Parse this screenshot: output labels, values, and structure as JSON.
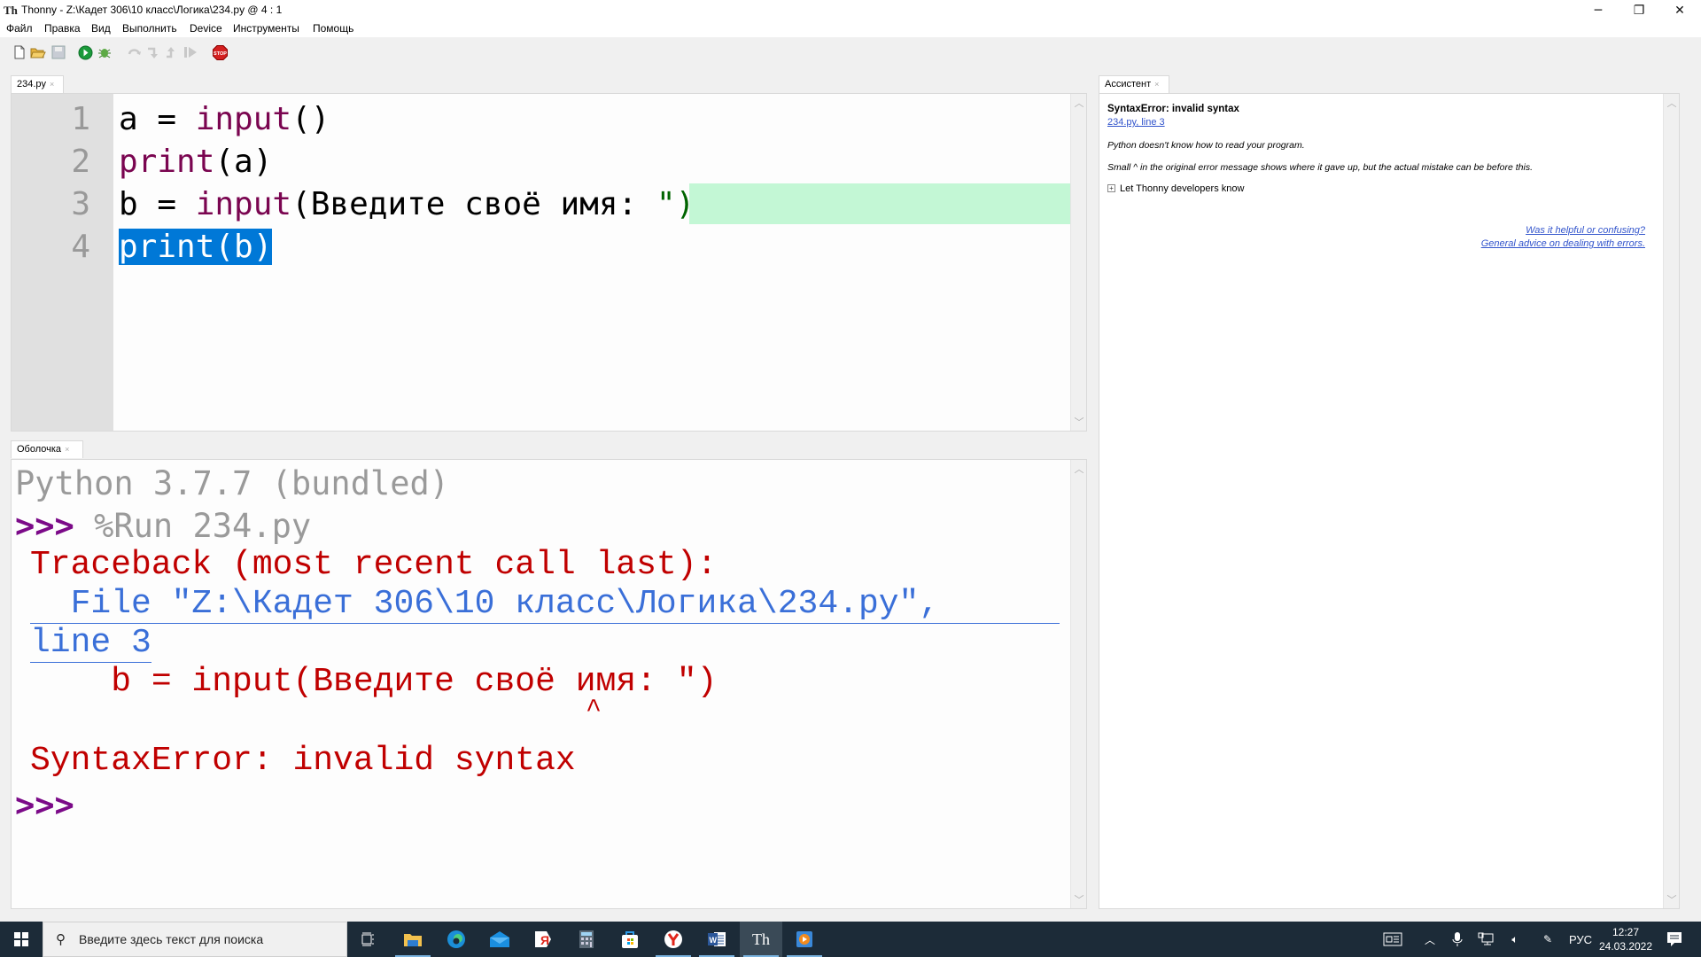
{
  "window": {
    "app_icon": "Th",
    "title": "Thonny  -  Z:\\Кадет 306\\10 класс\\Логика\\234.py  @  4 : 1",
    "controls": {
      "minimize": "─",
      "restore": "❐",
      "close": "✕"
    }
  },
  "menu": [
    "Файл",
    "Правка",
    "Вид",
    "Выполнить",
    "Device",
    "Инструменты",
    "Помощь"
  ],
  "toolbar": {
    "buttons": [
      {
        "name": "new-file",
        "icon": "new-file-icon",
        "enabled": true
      },
      {
        "name": "open-file",
        "icon": "folder-open-icon",
        "enabled": true
      },
      {
        "name": "save-file",
        "icon": "save-icon",
        "enabled": false
      },
      {
        "name": "run",
        "icon": "run-icon",
        "enabled": true
      },
      {
        "name": "debug",
        "icon": "bug-icon",
        "enabled": true
      },
      {
        "name": "step-over",
        "icon": "step-over-icon",
        "enabled": false
      },
      {
        "name": "step-into",
        "icon": "step-into-icon",
        "enabled": false
      },
      {
        "name": "step-out",
        "icon": "step-out-icon",
        "enabled": false
      },
      {
        "name": "resume",
        "icon": "resume-icon",
        "enabled": false
      },
      {
        "name": "stop",
        "icon": "stop-icon",
        "label": "STOP",
        "enabled": true
      }
    ]
  },
  "editor": {
    "tab": {
      "label": "234.py",
      "close": "×"
    },
    "lines": [
      {
        "n": "1",
        "tokens": [
          [
            "a = ",
            "plain"
          ],
          [
            "input",
            "kw"
          ],
          [
            "()",
            "plain"
          ]
        ]
      },
      {
        "n": "2",
        "tokens": [
          [
            "print",
            "kw"
          ],
          [
            "(a)",
            "plain"
          ]
        ]
      },
      {
        "n": "3",
        "tokens": [
          [
            "b = ",
            "plain"
          ],
          [
            "input",
            "kw"
          ],
          [
            "(Введите своё имя: ",
            "plain"
          ],
          [
            "\")",
            "str"
          ]
        ]
      },
      {
        "n": "4",
        "tokens": [
          [
            "print(b)",
            "sel"
          ]
        ]
      }
    ],
    "error_line": 3,
    "selected_line": 4
  },
  "shell": {
    "tab": {
      "label": "Оболочка",
      "close": "×"
    },
    "banner": "Python 3.7.7 (bundled)",
    "prompt": ">>>",
    "command": " %Run 234.py",
    "traceback_header": "Traceback (most recent call last):",
    "traceback_file": "  File \"Z:\\Кадет 306\\10 класс\\Логика\\234.py\",",
    "traceback_line": "line 3",
    "source_line": "    b = input(Введите своё имя: \")",
    "caret": "^",
    "error": "SyntaxError: invalid syntax",
    "final_prompt": ">>>"
  },
  "assistant": {
    "tab": {
      "label": "Ассистент",
      "close": "×"
    },
    "title": "SyntaxError: invalid syntax",
    "location_link": "234.py, line 3",
    "paragraphs": [
      "Python doesn't know how to read your program.",
      "Small ^ in the original error message shows where it gave up, but the actual mistake can be before this."
    ],
    "expand_label": "Let Thonny developers know",
    "links": [
      "Was it helpful or confusing?",
      "General advice on dealing with errors."
    ]
  },
  "taskbar": {
    "search_placeholder": "Введите здесь текст для поиска",
    "apps": [
      {
        "name": "task-view",
        "icon": "task-view-icon"
      },
      {
        "name": "file-explorer",
        "icon": "folder-icon",
        "running": true
      },
      {
        "name": "edge",
        "icon": "edge-icon"
      },
      {
        "name": "mail",
        "icon": "mail-icon"
      },
      {
        "name": "yandex",
        "icon": "yandex-icon"
      },
      {
        "name": "calculator",
        "icon": "calculator-icon"
      },
      {
        "name": "store",
        "icon": "store-icon"
      },
      {
        "name": "yandex-browser",
        "icon": "yandex-browser-icon",
        "running": true
      },
      {
        "name": "word",
        "icon": "word-icon",
        "running": true
      },
      {
        "name": "thonny",
        "icon": "thonny-icon",
        "running": true,
        "active": true
      },
      {
        "name": "media-player",
        "icon": "media-player-icon",
        "running": true
      }
    ],
    "tray": {
      "language": "РУС",
      "time": "12:27",
      "date": "24.03.2022"
    }
  }
}
